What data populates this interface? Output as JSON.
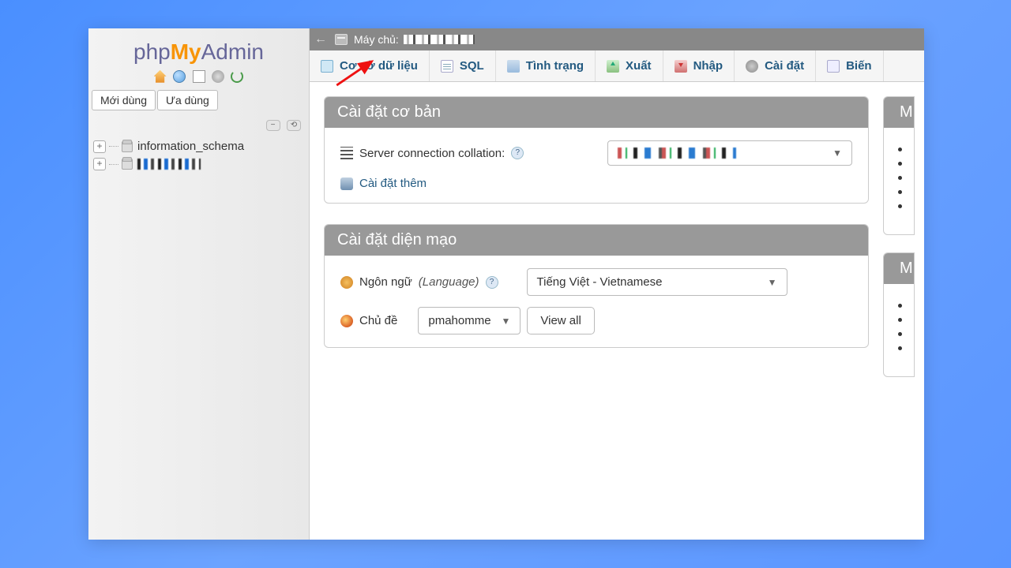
{
  "logo": {
    "php": "php",
    "my": "My",
    "admin": "Admin"
  },
  "sidebar": {
    "recent_label": "Mới dùng",
    "favorites_label": "Ưa dùng",
    "collapse_label": "−",
    "dbs": [
      {
        "name": "information_schema",
        "blurred": false
      },
      {
        "name": "",
        "blurred": true
      }
    ]
  },
  "hostbar": {
    "server_label": "Máy chủ:"
  },
  "tabs": [
    {
      "id": "databases",
      "label": "Cơ sở dữ liệu",
      "icon": "ico-db"
    },
    {
      "id": "sql",
      "label": "SQL",
      "icon": "ico-sql"
    },
    {
      "id": "status",
      "label": "Tình trạng",
      "icon": "ico-status"
    },
    {
      "id": "export",
      "label": "Xuất",
      "icon": "ico-export"
    },
    {
      "id": "import",
      "label": "Nhập",
      "icon": "ico-import"
    },
    {
      "id": "settings",
      "label": "Cài đặt",
      "icon": "ico-settings"
    },
    {
      "id": "variables",
      "label": "Biến",
      "icon": "ico-vars"
    }
  ],
  "panels": {
    "general": {
      "title": "Cài đặt cơ bản",
      "collation_label": "Server connection collation:",
      "more_settings": "Cài đặt thêm"
    },
    "appearance": {
      "title": "Cài đặt diện mạo",
      "language_label": "Ngôn ngữ",
      "language_hint": "(Language)",
      "language_value": "Tiếng Việt - Vietnamese",
      "theme_label": "Chủ đề",
      "theme_value": "pmahomme",
      "view_all": "View all"
    },
    "right": [
      {
        "title": "M",
        "bullets": 5
      },
      {
        "title": "M",
        "bullets": 4
      }
    ]
  }
}
